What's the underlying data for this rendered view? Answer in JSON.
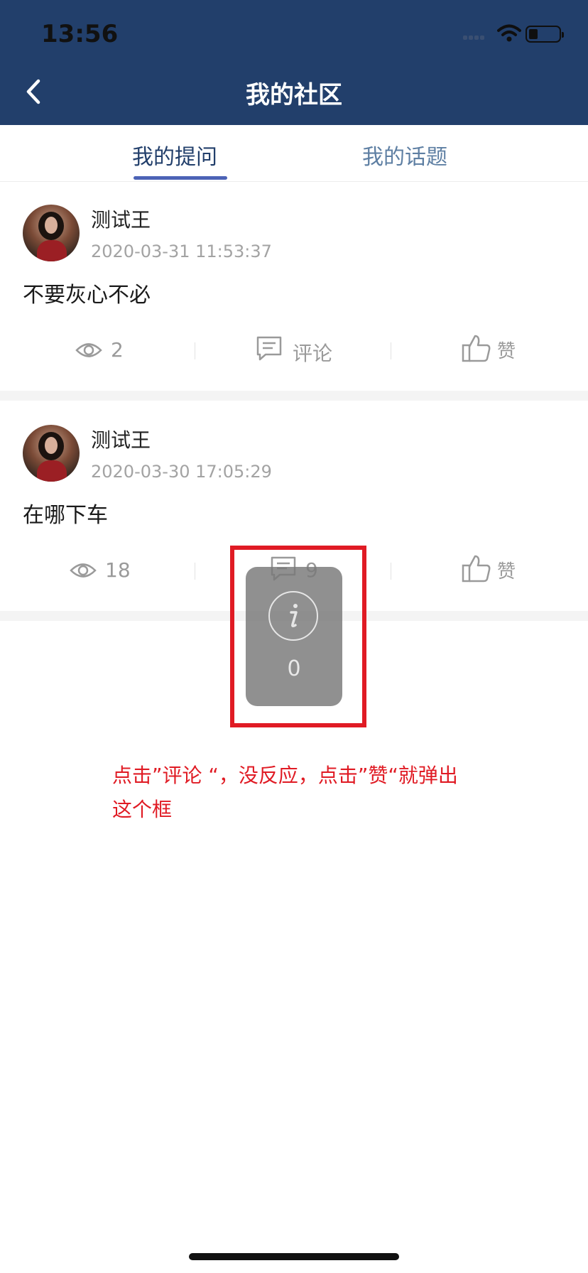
{
  "status_bar": {
    "time": "13:56"
  },
  "header": {
    "title": "我的社区"
  },
  "tabs": [
    {
      "label": "我的提问",
      "active": true
    },
    {
      "label": "我的话题",
      "active": false
    }
  ],
  "posts": [
    {
      "username": "测试王",
      "timestamp": "2020-03-31 11:53:37",
      "text": "不要灰心不必",
      "views": "2",
      "comment_label": "评论",
      "like_label": "赞"
    },
    {
      "username": "测试王",
      "timestamp": "2020-03-30 17:05:29",
      "text": "在哪下车",
      "views": "18",
      "comment_label": "9",
      "like_label": "赞"
    }
  ],
  "toast": {
    "count": "0",
    "icon": "info-icon"
  },
  "annotation": {
    "line1": "点击”评论 “，没反应，点击”赞“就弹出",
    "line2": "这个框",
    "color": "#e01b24"
  },
  "colors": {
    "header_bg": "#223F6B",
    "tab_active": "#223F6B",
    "tab_inactive": "#5e7fa3",
    "tab_indicator": "#4C63B6"
  }
}
